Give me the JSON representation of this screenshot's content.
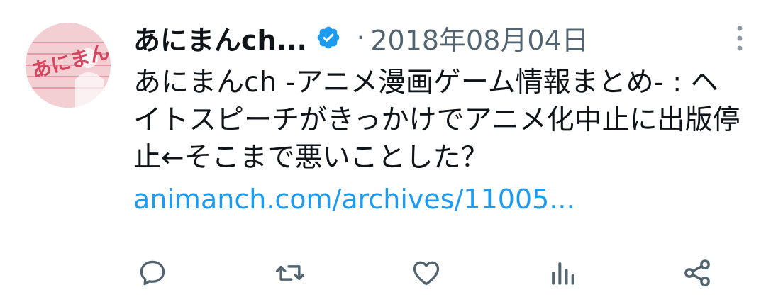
{
  "tweet": {
    "author_name": "あにまんch...",
    "separator": "·",
    "date": "2018年08月04日",
    "text": "あにまんch -アニメ漫画ゲーム情報まとめ- : ヘイトスピーチがきっかけでアニメ化中止に出版停止←そこまで悪いことした？",
    "link": "animanch.com/archives/11005...",
    "avatar_text": "あにまん"
  },
  "icons": {
    "verified": "verified-badge-icon",
    "more": "more-options-icon",
    "reply": "reply-icon",
    "retweet": "retweet-icon",
    "like": "like-icon",
    "views": "views-icon",
    "share": "share-icon"
  },
  "colors": {
    "link": "#1d9bf0",
    "verified": "#1d9bf0",
    "muted": "#536471",
    "text": "#0f1419"
  }
}
